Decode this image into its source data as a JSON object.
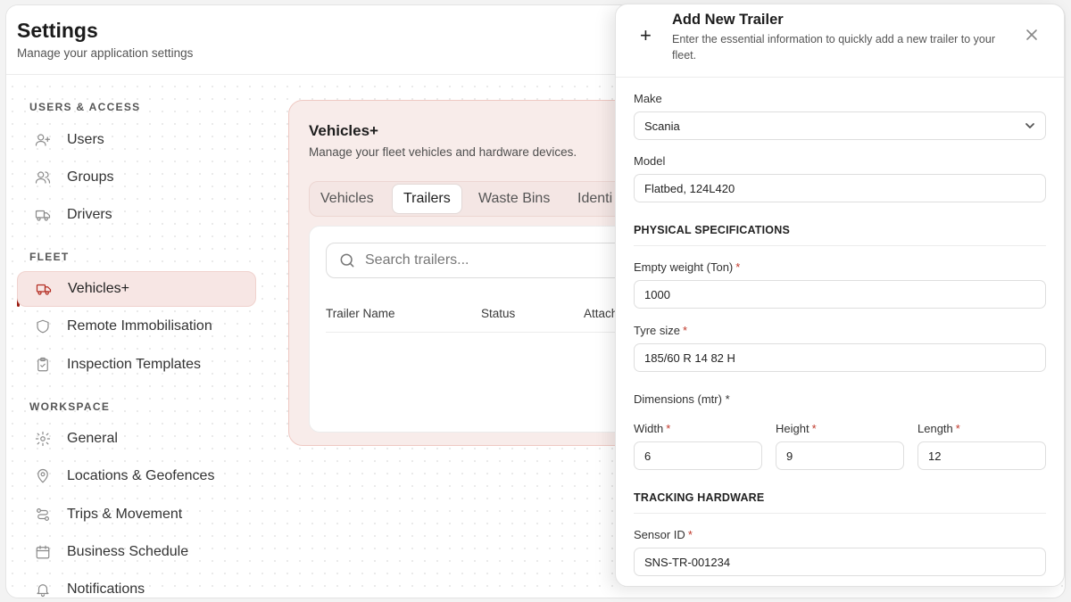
{
  "header": {
    "title": "Settings",
    "subtitle": "Manage your application settings"
  },
  "sidebar": {
    "sections": [
      {
        "label": "USERS & ACCESS"
      },
      {
        "label": "FLEET"
      },
      {
        "label": "WORKSPACE"
      }
    ],
    "items": [
      {
        "label": "Users",
        "icon": "user-plus-icon"
      },
      {
        "label": "Groups",
        "icon": "users-icon"
      },
      {
        "label": "Drivers",
        "icon": "truck-icon"
      },
      {
        "label": "Vehicles+",
        "icon": "truck-icon",
        "active": true
      },
      {
        "label": "Remote Immobilisation",
        "icon": "shield-icon"
      },
      {
        "label": "Inspection Templates",
        "icon": "clipboard-check-icon"
      },
      {
        "label": "General",
        "icon": "gear-icon"
      },
      {
        "label": "Locations & Geofences",
        "icon": "map-pin-icon"
      },
      {
        "label": "Trips & Movement",
        "icon": "route-icon"
      },
      {
        "label": "Business Schedule",
        "icon": "calendar-icon"
      },
      {
        "label": "Notifications",
        "icon": "bell-icon"
      }
    ]
  },
  "main": {
    "title": "Vehicles+",
    "subtitle": "Manage your fleet vehicles and hardware devices.",
    "tabs": [
      {
        "label": "Vehicles"
      },
      {
        "label": "Trailers",
        "active": true
      },
      {
        "label": "Waste Bins"
      },
      {
        "label": "Identi"
      }
    ],
    "search": {
      "placeholder": "Search trailers..."
    },
    "columns": [
      "Trailer Name",
      "Status",
      "Attach"
    ]
  },
  "panel": {
    "title": "Add New Trailer",
    "subtitle": "Enter the essential information to quickly add a new trailer to your fleet.",
    "make": {
      "label": "Make",
      "value": "Scania"
    },
    "model": {
      "label": "Model",
      "value": "Flatbed, 124L420"
    },
    "physical_heading": "PHYSICAL SPECIFICATIONS",
    "empty_weight": {
      "label": "Empty weight (Ton)",
      "value": "1000"
    },
    "tyre_size": {
      "label": "Tyre size",
      "value": "185/60 R 14 82 H"
    },
    "dimensions_label": "Dimensions (mtr)",
    "width": {
      "label": "Width",
      "value": "6"
    },
    "height": {
      "label": "Height",
      "value": "9"
    },
    "length": {
      "label": "Length",
      "value": "12"
    },
    "tracking_heading": "TRACKING HARDWARE",
    "sensor_id": {
      "label": "Sensor ID",
      "value": "SNS-TR-001234"
    },
    "required_mark": "*"
  },
  "colors": {
    "accent": "#9b1c12",
    "active_bg": "#f7e6e4",
    "required": "#c0392b"
  }
}
